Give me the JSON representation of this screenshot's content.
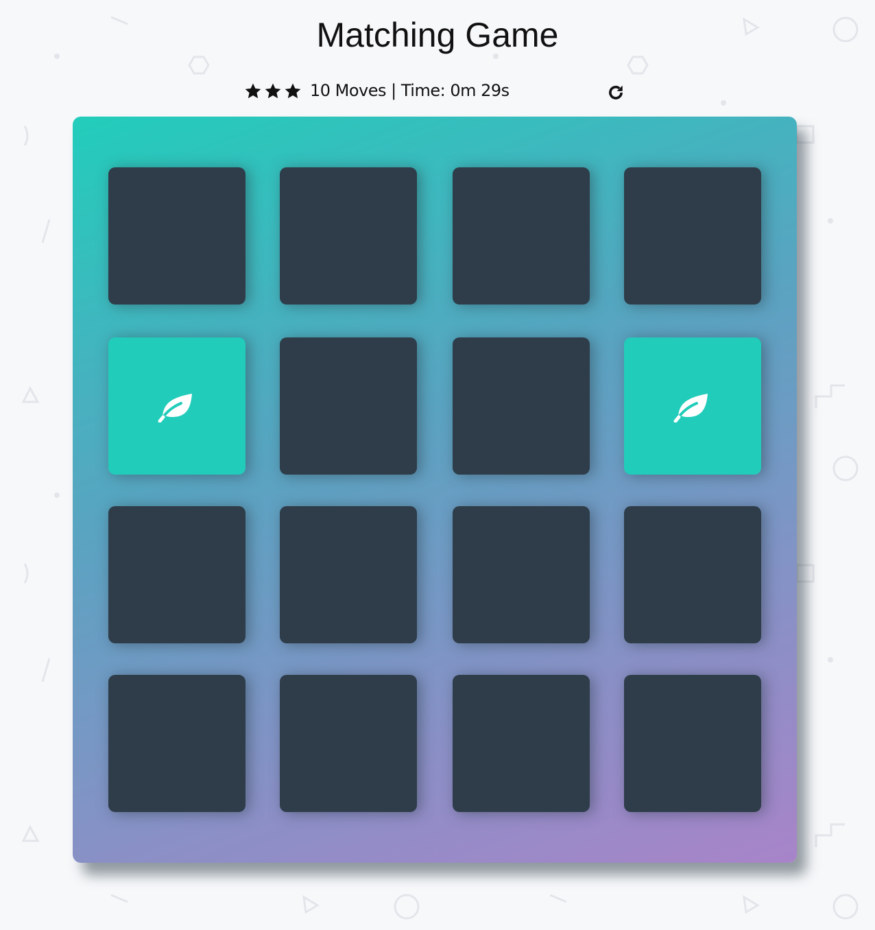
{
  "header": {
    "title": "Matching Game"
  },
  "score_panel": {
    "star_icon": "star-icon",
    "stars_filled": 3,
    "stars_total": 3,
    "moves_text": "10 Moves | Time: 0m 29s",
    "restart_icon": "repeat-icon"
  },
  "deck": {
    "rows": 4,
    "columns": 4,
    "cards": [
      {
        "state": "face-down",
        "icon": ""
      },
      {
        "state": "face-down",
        "icon": ""
      },
      {
        "state": "face-down",
        "icon": ""
      },
      {
        "state": "face-down",
        "icon": ""
      },
      {
        "state": "match",
        "icon": "leaf-icon"
      },
      {
        "state": "face-down",
        "icon": ""
      },
      {
        "state": "face-down",
        "icon": ""
      },
      {
        "state": "match",
        "icon": "leaf-icon"
      },
      {
        "state": "face-down",
        "icon": ""
      },
      {
        "state": "face-down",
        "icon": ""
      },
      {
        "state": "face-down",
        "icon": ""
      },
      {
        "state": "face-down",
        "icon": ""
      },
      {
        "state": "face-down",
        "icon": ""
      },
      {
        "state": "face-down",
        "icon": ""
      },
      {
        "state": "face-down",
        "icon": ""
      },
      {
        "state": "face-down",
        "icon": ""
      }
    ]
  },
  "colors": {
    "page_background": "#f7f8fa",
    "card_back": "#2e3d49",
    "card_match": "#22ccba",
    "deck_gradient_start": "#22cdbb",
    "deck_gradient_end": "#a884c9"
  }
}
